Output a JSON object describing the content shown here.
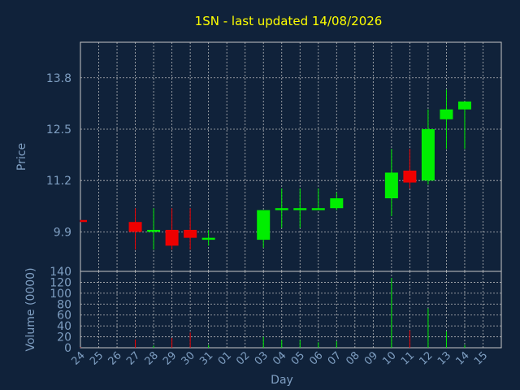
{
  "chart_data": {
    "type": "candlestick",
    "title": "1SN - last updated 14/08/2026",
    "xlabel": "Day",
    "ylabel": "Price",
    "volume_label": "Volume (0000)",
    "x_tick_labels": [
      "24",
      "25",
      "26",
      "27",
      "28",
      "29",
      "30",
      "31",
      "01",
      "02",
      "03",
      "04",
      "05",
      "06",
      "07",
      "08",
      "09",
      "10",
      "11",
      "12",
      "13",
      "14",
      "15"
    ],
    "price_ticks": [
      9.9,
      11.2,
      12.5,
      13.8
    ],
    "price_ylim": [
      8.9,
      14.7
    ],
    "volume_ticks": [
      0,
      20,
      40,
      60,
      80,
      100,
      120,
      140
    ],
    "volume_ylim": [
      0,
      140
    ],
    "grid": true,
    "up_color": "#00ee00",
    "down_color": "#ee0000",
    "background": "#10223a",
    "candles": [
      {
        "day": "24",
        "open": 10.2,
        "close": 10.15,
        "high": 10.2,
        "low": 10.15,
        "volume": 1
      },
      {
        "day": "27",
        "open": 10.15,
        "close": 9.9,
        "high": 10.5,
        "low": 9.45,
        "volume": 15
      },
      {
        "day": "28",
        "open": 9.9,
        "close": 9.95,
        "high": 10.5,
        "low": 9.45,
        "volume": 4
      },
      {
        "day": "29",
        "open": 9.95,
        "close": 9.55,
        "high": 10.5,
        "low": 9.45,
        "volume": 18
      },
      {
        "day": "30",
        "open": 9.95,
        "close": 9.75,
        "high": 10.5,
        "low": 9.45,
        "volume": 28
      },
      {
        "day": "31",
        "open": 9.7,
        "close": 9.75,
        "high": 9.95,
        "low": 9.55,
        "volume": 5
      },
      {
        "day": "03",
        "open": 9.7,
        "close": 10.45,
        "high": 10.45,
        "low": 9.5,
        "volume": 20
      },
      {
        "day": "04",
        "open": 10.45,
        "close": 10.5,
        "high": 11.0,
        "low": 10.0,
        "volume": 14
      },
      {
        "day": "05",
        "open": 10.45,
        "close": 10.5,
        "high": 11.0,
        "low": 10.0,
        "volume": 14
      },
      {
        "day": "06",
        "open": 10.45,
        "close": 10.5,
        "high": 11.0,
        "low": 10.45,
        "volume": 10
      },
      {
        "day": "07",
        "open": 10.5,
        "close": 10.75,
        "high": 10.9,
        "low": 10.45,
        "volume": 12
      },
      {
        "day": "10",
        "open": 10.75,
        "close": 11.4,
        "high": 12.0,
        "low": 10.3,
        "volume": 128
      },
      {
        "day": "11",
        "open": 11.45,
        "close": 11.15,
        "high": 12.0,
        "low": 11.0,
        "volume": 32
      },
      {
        "day": "12",
        "open": 11.2,
        "close": 12.5,
        "high": 13.0,
        "low": 11.1,
        "volume": 72
      },
      {
        "day": "13",
        "open": 12.75,
        "close": 13.0,
        "high": 13.5,
        "low": 12.0,
        "volume": 30
      },
      {
        "day": "14",
        "open": 13.0,
        "close": 13.2,
        "high": 13.2,
        "low": 12.0,
        "volume": 5
      }
    ]
  }
}
